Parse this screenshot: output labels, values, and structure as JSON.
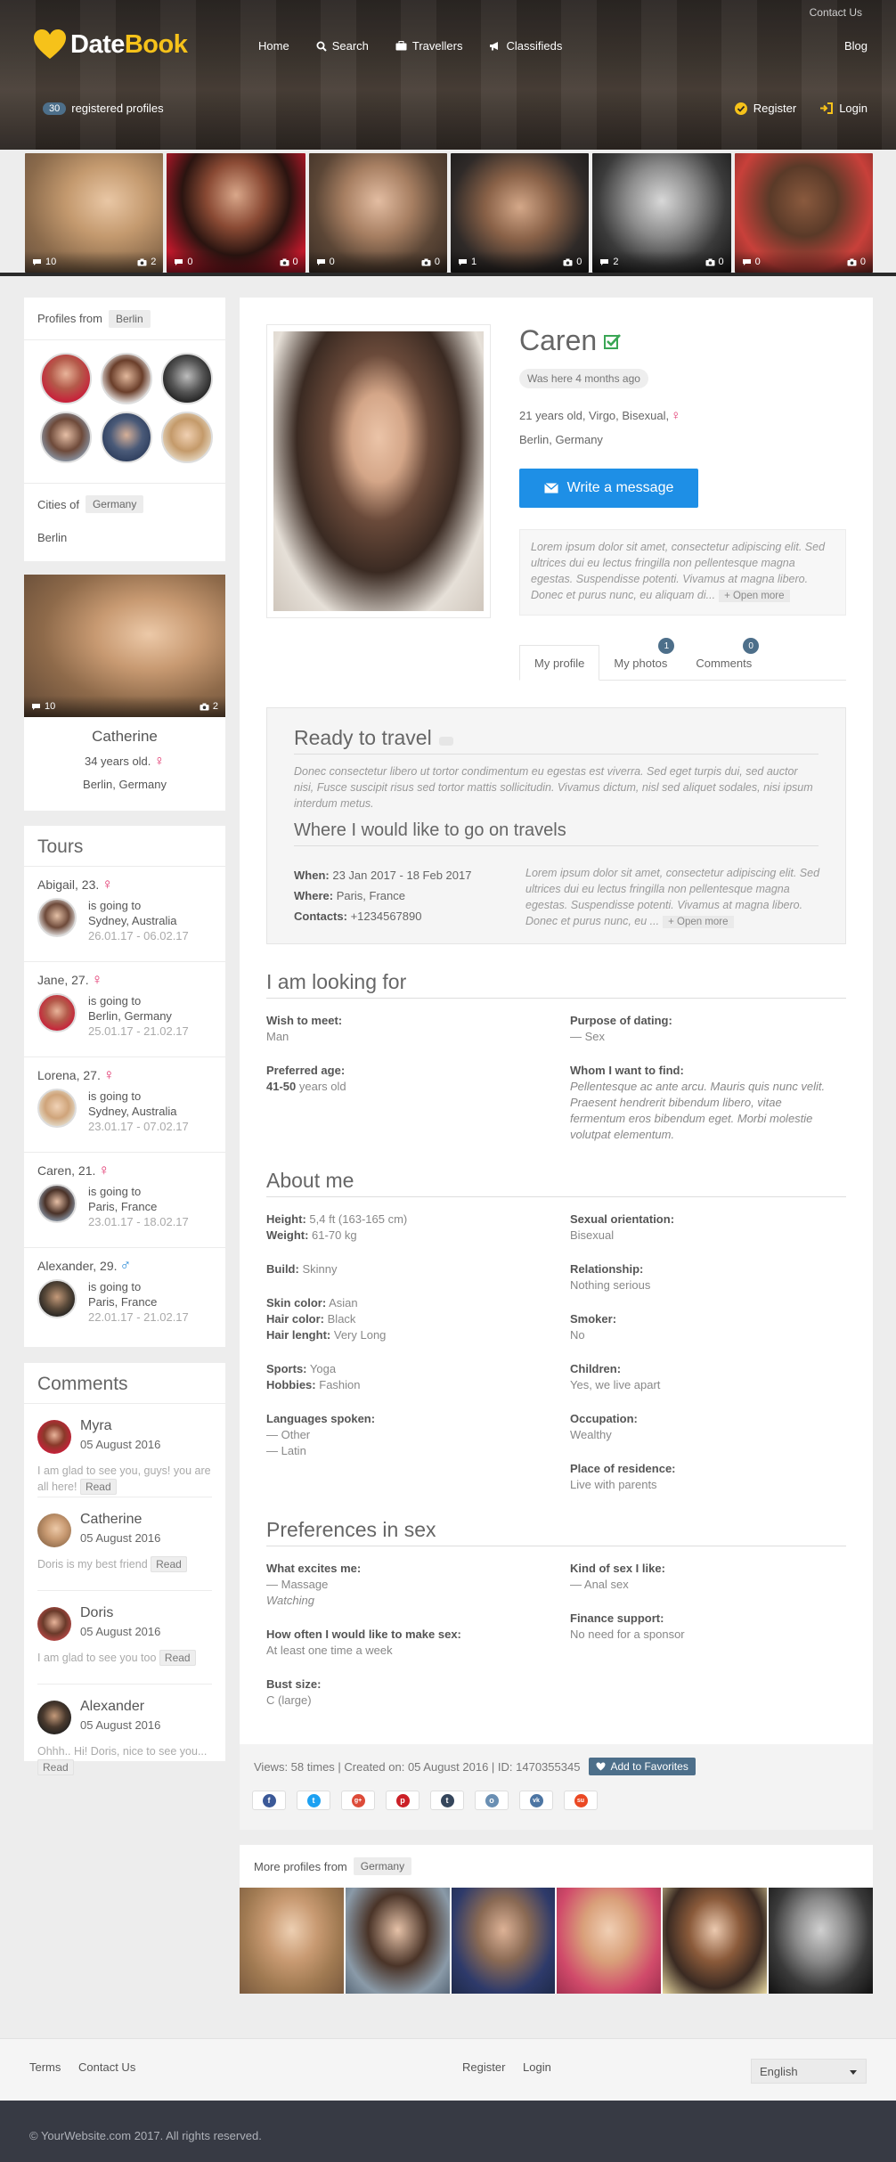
{
  "header": {
    "contact_top": "Contact Us",
    "logo_part1": "Date",
    "logo_part2": "Book",
    "nav": [
      "Home",
      "Search",
      "Travellers",
      "Classifieds"
    ],
    "blog": "Blog",
    "registered_count": "30",
    "registered_label": "registered profiles",
    "register": "Register",
    "login": "Login"
  },
  "strip": [
    {
      "comments": "10",
      "photos": "2"
    },
    {
      "comments": "0",
      "photos": "0"
    },
    {
      "comments": "0",
      "photos": "0"
    },
    {
      "comments": "1",
      "photos": "0"
    },
    {
      "comments": "2",
      "photos": "0"
    },
    {
      "comments": "0",
      "photos": "0"
    }
  ],
  "sidebar": {
    "profiles_from": "Profiles from",
    "profiles_city": "Berlin",
    "cities_of": "Cities of",
    "cities_country": "Germany",
    "city": "Berlin",
    "featured": {
      "name": "Catherine",
      "age": "34 years old.",
      "location": "Berlin, Germany",
      "comments": "10",
      "photos": "2"
    },
    "tours_title": "Tours",
    "tours": [
      {
        "name": "Abigail, 23.",
        "sex": "♀",
        "going": "is going to",
        "dest": "Sydney, Australia",
        "dates": "26.01.17 - 06.02.17"
      },
      {
        "name": "Jane, 27.",
        "sex": "♀",
        "going": "is going to",
        "dest": "Berlin, Germany",
        "dates": "25.01.17 - 21.02.17"
      },
      {
        "name": "Lorena, 27.",
        "sex": "♀",
        "going": "is going to",
        "dest": "Sydney, Australia",
        "dates": "23.01.17 - 07.02.17"
      },
      {
        "name": "Caren, 21.",
        "sex": "♀",
        "going": "is going to",
        "dest": "Paris, France",
        "dates": "23.01.17 - 18.02.17"
      },
      {
        "name": "Alexander, 29.",
        "sex": "♂",
        "going": "is going to",
        "dest": "Paris, France",
        "dates": "22.01.17 - 21.02.17"
      }
    ],
    "comments_title": "Comments",
    "comments": [
      {
        "name": "Myra",
        "date": "05 August 2016",
        "text": "I am glad to see you, guys! you are all here!",
        "read": "Read"
      },
      {
        "name": "Catherine",
        "date": "05 August 2016",
        "text": "Doris is my best friend",
        "read": "Read"
      },
      {
        "name": "Doris",
        "date": "05 August 2016",
        "text": "I am glad to see you too",
        "read": "Read"
      },
      {
        "name": "Alexander",
        "date": "05 August 2016",
        "text": "Ohhh.. Hi! Doris, nice to see you...",
        "read": "Read"
      }
    ]
  },
  "profile": {
    "name": "Caren",
    "last_seen": "Was here 4 months ago",
    "info": "21 years old, Virgo, Bisexual,",
    "location": "Berlin, Germany",
    "write_message": "Write a message",
    "bio": "Lorem ipsum dolor sit amet, consectetur adipiscing elit. Sed ultrices dui eu lectus fringilla non pellentesque magna egestas. Suspendisse potenti. Vivamus at magna libero. Donec et purus nunc, eu aliquam di...",
    "open_more": "+ Open more",
    "tabs": [
      {
        "label": "My profile",
        "count": ""
      },
      {
        "label": "My photos",
        "count": "1"
      },
      {
        "label": "Comments",
        "count": "0"
      }
    ]
  },
  "travel": {
    "title": "Ready to travel",
    "desc": "Donec consectetur libero ut tortor condimentum eu egestas est viverra. Sed eget turpis dui, sed auctor nisi, Fusce suscipit risus sed tortor mattis sollicitudin. Vivamus dictum, nisl sed aliquet sodales, nisi ipsum interdum metus.",
    "where_title": "Where I would like to go on travels",
    "when_label": "When:",
    "when": "23 Jan 2017 - 18 Feb 2017",
    "where_label": "Where:",
    "where": "Paris, France",
    "contacts_label": "Contacts:",
    "contacts": "+1234567890",
    "right_text": "Lorem ipsum dolor sit amet, consectetur adipiscing elit. Sed ultrices dui eu lectus fringilla non pellentesque magna egestas. Suspendisse potenti. Vivamus at magna libero. Donec et purus nunc, eu ...",
    "open_more": "+ Open more"
  },
  "looking": {
    "title": "I am looking for",
    "wish_label": "Wish to meet:",
    "wish": "Man",
    "purpose_label": "Purpose of dating:",
    "purpose": "— Sex",
    "age_label": "Preferred age:",
    "age_range": "41-50",
    "age_suffix": "years old",
    "whom_label": "Whom I want to find:",
    "whom": "Pellentesque ac ante arcu. Mauris quis nunc velit. Praesent hendrerit bibendum libero, vitae fermentum eros bibendum eget. Morbi molestie volutpat elementum."
  },
  "about": {
    "title": "About me",
    "height_label": "Height:",
    "height": "5,4 ft (163-165 cm)",
    "weight_label": "Weight:",
    "weight": "61-70 kg",
    "build_label": "Build:",
    "build": "Skinny",
    "skin_label": "Skin color:",
    "skin": "Asian",
    "hair_label": "Hair color:",
    "hair": "Black",
    "hairlen_label": "Hair lenght:",
    "hairlen": "Very Long",
    "sports_label": "Sports:",
    "sports": "Yoga",
    "hobbies_label": "Hobbies:",
    "hobbies": "Fashion",
    "lang_label": "Languages spoken:",
    "lang1": "— Other",
    "lang2": "— Latin",
    "orient_label": "Sexual orientation:",
    "orient": "Bisexual",
    "rel_label": "Relationship:",
    "rel": "Nothing serious",
    "smoker_label": "Smoker:",
    "smoker": "No",
    "children_label": "Children:",
    "children": "Yes, we live apart",
    "occ_label": "Occupation:",
    "occ": "Wealthy",
    "residence_label": "Place of residence:",
    "residence": "Live with parents"
  },
  "prefs": {
    "title": "Preferences in sex",
    "excites_label": "What excites me:",
    "excites1": "— Massage",
    "excites2": "Watching",
    "often_label": "How often I would like to make sex:",
    "often": "At least one time a week",
    "bust_label": "Bust size:",
    "bust": "C (large)",
    "kind_label": "Kind of sex I like:",
    "kind": "— Anal sex",
    "finance_label": "Finance support:",
    "finance": "No need for a sponsor"
  },
  "bottom": {
    "meta": "Views: 58 times | Created on: 05 August 2016 | ID: 1470355345",
    "add_fav": "Add to Favorites",
    "shares": [
      {
        "icon": "facebook-icon",
        "color": "#3b5998",
        "glyph": "f"
      },
      {
        "icon": "twitter-icon",
        "color": "#1da1f2",
        "glyph": "t"
      },
      {
        "icon": "google-plus-icon",
        "color": "#dd4b39",
        "glyph": "g+"
      },
      {
        "icon": "pinterest-icon",
        "color": "#cb2027",
        "glyph": "p"
      },
      {
        "icon": "tumblr-icon",
        "color": "#35465c",
        "glyph": "t"
      },
      {
        "icon": "odnoklassniki-icon",
        "color": "#6a8fb3",
        "glyph": "o"
      },
      {
        "icon": "vk-icon",
        "color": "#4c75a3",
        "glyph": "vk"
      },
      {
        "icon": "stumbleupon-icon",
        "color": "#eb4924",
        "glyph": "su"
      }
    ]
  },
  "more": {
    "label": "More profiles from",
    "country": "Germany"
  },
  "footer": {
    "terms": "Terms",
    "contact": "Contact Us",
    "register": "Register",
    "login": "Login",
    "language": "English",
    "copyright": "© YourWebsite.com 2017. All rights reserved."
  },
  "colors": {
    "accent": "#1e8fe6",
    "logo_yellow": "#f6c21a",
    "badge": "#4d6f8a",
    "female": "#e0316b",
    "male": "#2a8ad6"
  }
}
